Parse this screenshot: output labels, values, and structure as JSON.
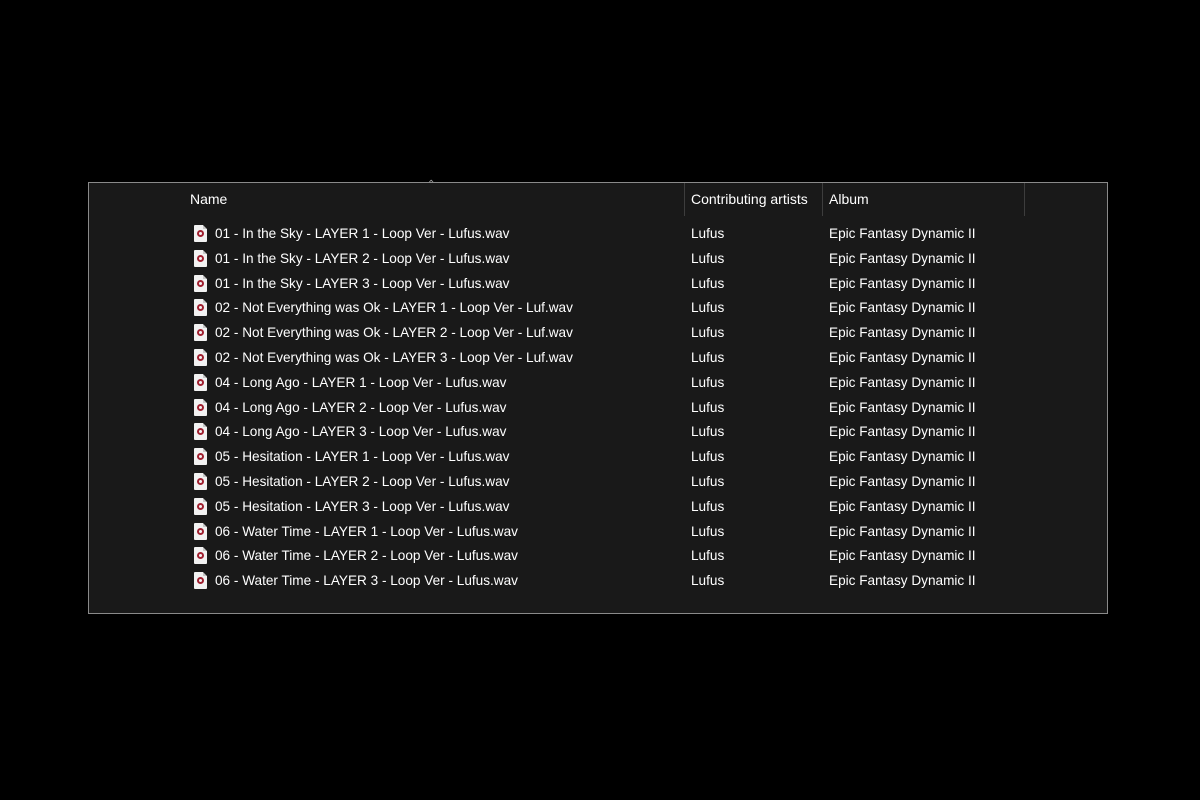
{
  "columns": {
    "name": "Name",
    "contributing_artists": "Contributing artists",
    "album": "Album",
    "sort_indicator": "^"
  },
  "files": [
    {
      "name": "01 - In the Sky - LAYER 1 - Loop Ver - Lufus.wav",
      "artist": "Lufus",
      "album": "Epic Fantasy Dynamic II"
    },
    {
      "name": "01 - In the Sky - LAYER 2 - Loop Ver - Lufus.wav",
      "artist": "Lufus",
      "album": "Epic Fantasy Dynamic II"
    },
    {
      "name": "01 - In the Sky - LAYER 3 - Loop Ver - Lufus.wav",
      "artist": "Lufus",
      "album": "Epic Fantasy Dynamic II"
    },
    {
      "name": "02 - Not Everything was Ok - LAYER 1 - Loop Ver - Luf.wav",
      "artist": "Lufus",
      "album": "Epic Fantasy Dynamic II"
    },
    {
      "name": "02 - Not Everything was Ok - LAYER 2 - Loop Ver - Luf.wav",
      "artist": "Lufus",
      "album": "Epic Fantasy Dynamic II"
    },
    {
      "name": "02 - Not Everything was Ok - LAYER 3 - Loop Ver - Luf.wav",
      "artist": "Lufus",
      "album": "Epic Fantasy Dynamic II"
    },
    {
      "name": "04 - Long Ago - LAYER 1 - Loop Ver - Lufus.wav",
      "artist": "Lufus",
      "album": "Epic Fantasy Dynamic II"
    },
    {
      "name": "04 - Long Ago - LAYER 2 - Loop Ver - Lufus.wav",
      "artist": "Lufus",
      "album": "Epic Fantasy Dynamic II"
    },
    {
      "name": "04 - Long Ago - LAYER 3 - Loop Ver - Lufus.wav",
      "artist": "Lufus",
      "album": "Epic Fantasy Dynamic II"
    },
    {
      "name": "05 - Hesitation - LAYER 1 - Loop Ver - Lufus.wav",
      "artist": "Lufus",
      "album": "Epic Fantasy Dynamic II"
    },
    {
      "name": "05 - Hesitation - LAYER 2 - Loop Ver - Lufus.wav",
      "artist": "Lufus",
      "album": "Epic Fantasy Dynamic II"
    },
    {
      "name": "05 - Hesitation - LAYER 3 - Loop Ver - Lufus.wav",
      "artist": "Lufus",
      "album": "Epic Fantasy Dynamic II"
    },
    {
      "name": "06 - Water Time - LAYER 1 - Loop Ver - Lufus.wav",
      "artist": "Lufus",
      "album": "Epic Fantasy Dynamic II"
    },
    {
      "name": "06 - Water Time - LAYER 2 - Loop Ver - Lufus.wav",
      "artist": "Lufus",
      "album": "Epic Fantasy Dynamic II"
    },
    {
      "name": "06 - Water Time - LAYER 3 - Loop Ver - Lufus.wav",
      "artist": "Lufus",
      "album": "Epic Fantasy Dynamic II"
    }
  ],
  "icons": {
    "file": "audio-file-icon",
    "sort": "sort-ascending-icon"
  },
  "colors": {
    "background": "#000000",
    "panel": "#191919",
    "text": "#ffffff",
    "icon_accent": "#a02030"
  }
}
